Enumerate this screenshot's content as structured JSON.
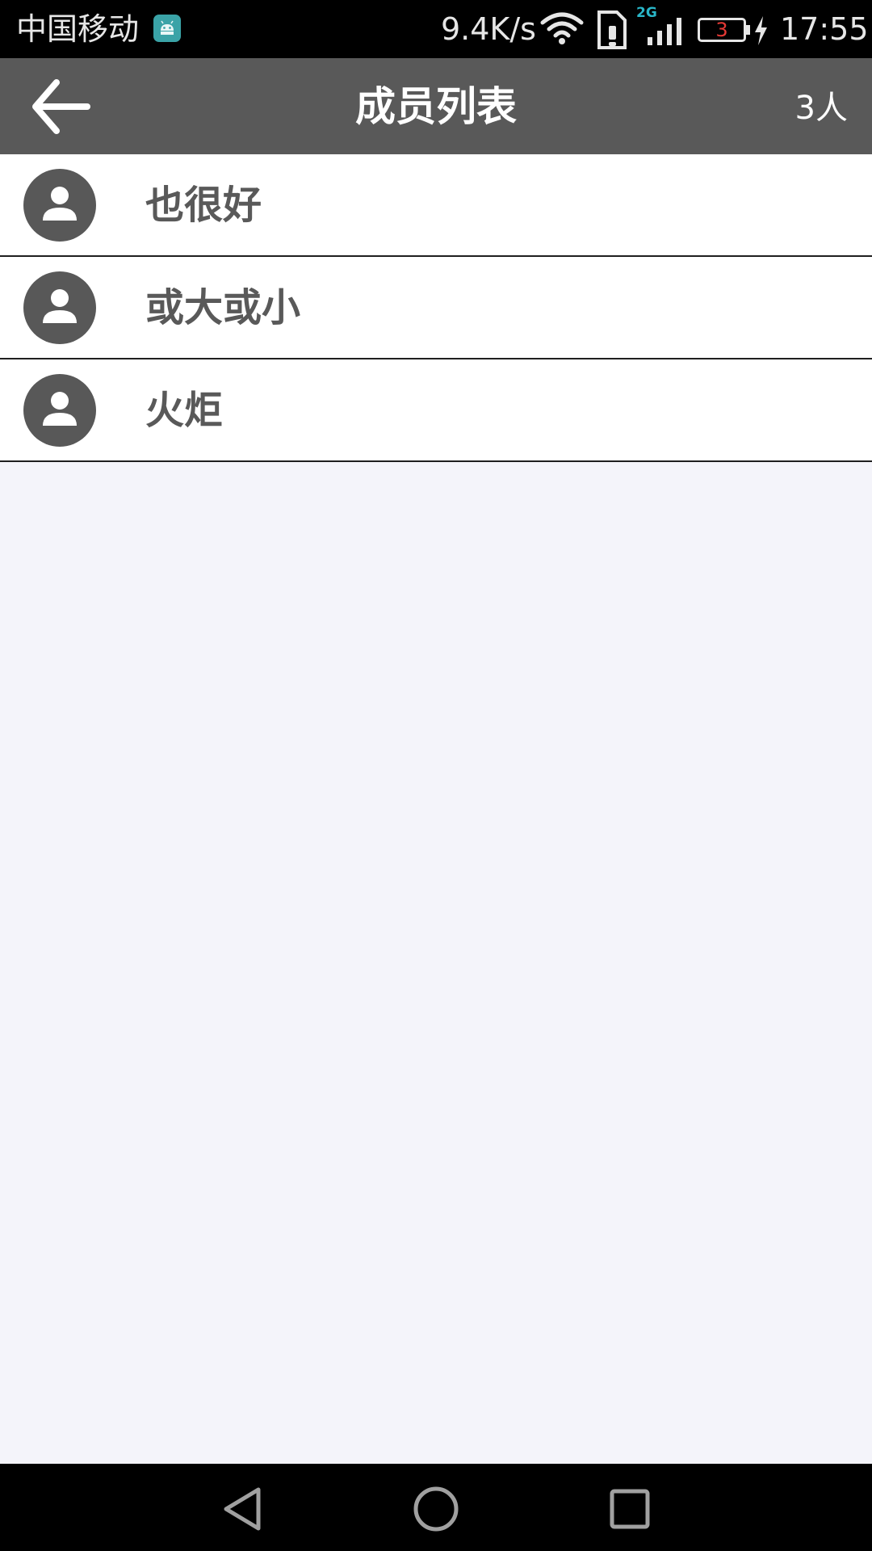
{
  "status_bar": {
    "carrier": "中国移动",
    "net_speed": "9.4K/s",
    "network_type": "2G",
    "battery_level": "3",
    "time": "17:55",
    "icons": [
      "android-notification-icon",
      "wifi-icon",
      "sim-alert-icon",
      "signal-icon",
      "battery-icon",
      "charging-icon"
    ],
    "colors": {
      "battery_level": "#e53935",
      "network_type": "#29b6c8",
      "notification": "#3aa3a7"
    }
  },
  "app_bar": {
    "back_icon": "arrow-left-icon",
    "title": "成员列表",
    "member_count": "3人",
    "background": "#595959"
  },
  "members": [
    {
      "name": "也很好",
      "avatar_icon": "person-icon"
    },
    {
      "name": "或大或小",
      "avatar_icon": "person-icon"
    },
    {
      "name": "火炬",
      "avatar_icon": "person-icon"
    }
  ],
  "nav_bar": {
    "buttons": [
      "back-triangle-icon",
      "home-circle-icon",
      "recents-square-icon"
    ]
  }
}
